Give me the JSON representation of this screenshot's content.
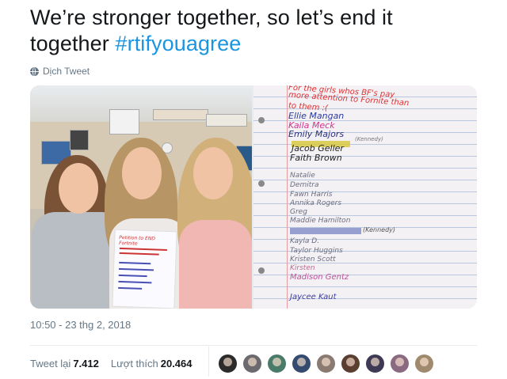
{
  "tweet": {
    "text_line1": "We’re stronger together, so let’s end it",
    "text_line2_plain": "together ",
    "hashtag": "#rtifyouagree",
    "translate_label": "Dịch Tweet",
    "timestamp": "10:50 - 23 thg 2, 2018"
  },
  "stats": {
    "retweets_label": "Tweet lại",
    "retweets_count": "7.412",
    "likes_label": "Lượt thích",
    "likes_count": "20.464"
  },
  "photo_left": {
    "sheet_title": "Petition to END Fortnite"
  },
  "photo_right": {
    "header_line1": "For the girls whos BF's pay",
    "header_line2": "more attention to Fornite than",
    "header_line3": "to them :(",
    "names": [
      {
        "text": "Ellie Mangan",
        "color": "#2a3a9e"
      },
      {
        "text": "Kaila Meck",
        "color": "#d2328c"
      },
      {
        "text": "Emily Majors",
        "color": "#27307a"
      },
      {
        "text": "Jacob Geller",
        "color": "#222222"
      },
      {
        "text": "Faith Brown",
        "color": "#222222"
      },
      {
        "text": "Natalie",
        "color": "#6a6d80"
      },
      {
        "text": "Demitra",
        "color": "#6a6d80"
      },
      {
        "text": "Fawn Harris",
        "color": "#6a6d80"
      },
      {
        "text": "Annika Rogers",
        "color": "#6a6d80"
      },
      {
        "text": "Greg",
        "color": "#6a6d80"
      },
      {
        "text": "Maddie Hamilton",
        "color": "#6a6d80"
      },
      {
        "text": "Kayla D.",
        "color": "#6a6d80"
      },
      {
        "text": "Taylor Huggins",
        "color": "#6a6d80"
      },
      {
        "text": "Kristen Scott",
        "color": "#6a6d80"
      },
      {
        "text": "Kirsten",
        "color": "#c06a8e"
      },
      {
        "text": "Madison Gentz",
        "color": "#c0509a"
      },
      {
        "text": "Jaycee Kaut",
        "color": "#3a3da0"
      }
    ],
    "annotations": {
      "cmnt1": "(Kennedy)",
      "cmnt2": "(Kennedy)"
    }
  },
  "retweeters_avatars": [
    "#2b2b2b",
    "#6c6a6e",
    "#4a7a6a",
    "#344a6e",
    "#8a7a72",
    "#5a3e30",
    "#3e3a55",
    "#8a6a80",
    "#a08a6e"
  ]
}
